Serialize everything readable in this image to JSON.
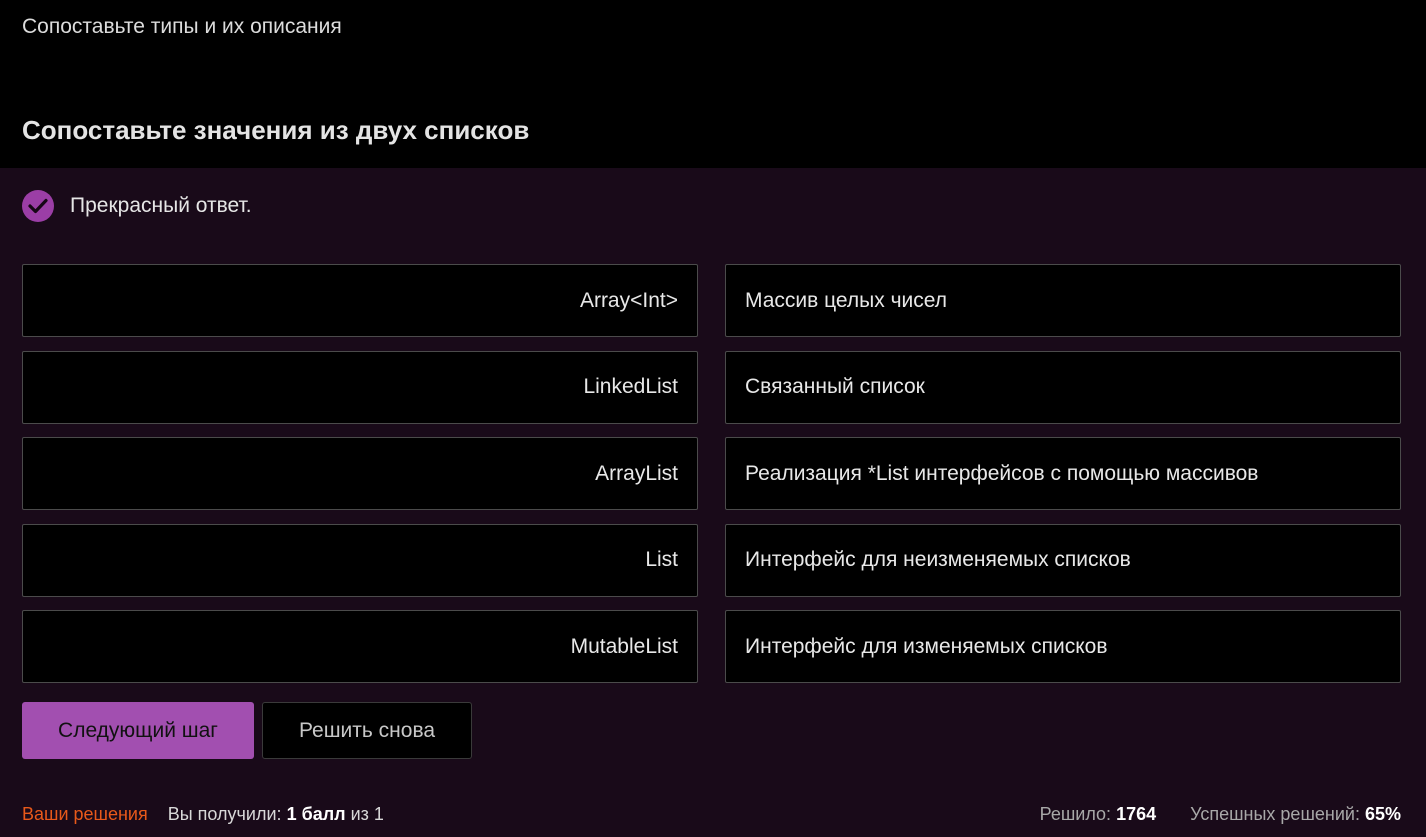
{
  "header": {
    "step_title": "Сопоставьте типы и их описания",
    "task_title": "Сопоставьте значения из двух списков"
  },
  "feedback": {
    "icon": "check-icon",
    "text": "Прекрасный ответ.",
    "accent_color": "#9b3ea6"
  },
  "pairs": [
    {
      "left": "Array<Int>",
      "right": "Массив целых чисел"
    },
    {
      "left": "LinkedList",
      "right": "Связанный список"
    },
    {
      "left": "ArrayList",
      "right": "Реализация *List интерфейсов с помощью массивов"
    },
    {
      "left": "List",
      "right": "Интерфейс для неизменяемых списков"
    },
    {
      "left": "MutableList",
      "right": "Интерфейс для изменяемых списков"
    }
  ],
  "buttons": {
    "next": "Следующий шаг",
    "retry": "Решить снова",
    "primary_color": "#a24fb0"
  },
  "footer": {
    "solutions_link": "Ваши решения",
    "score_prefix": "Вы получили:",
    "score_value": "1 балл",
    "score_suffix": "из 1",
    "solved_label": "Решило:",
    "solved_value": "1764",
    "success_label": "Успешных решений:",
    "success_value": "65%",
    "link_color": "#e8591a"
  }
}
